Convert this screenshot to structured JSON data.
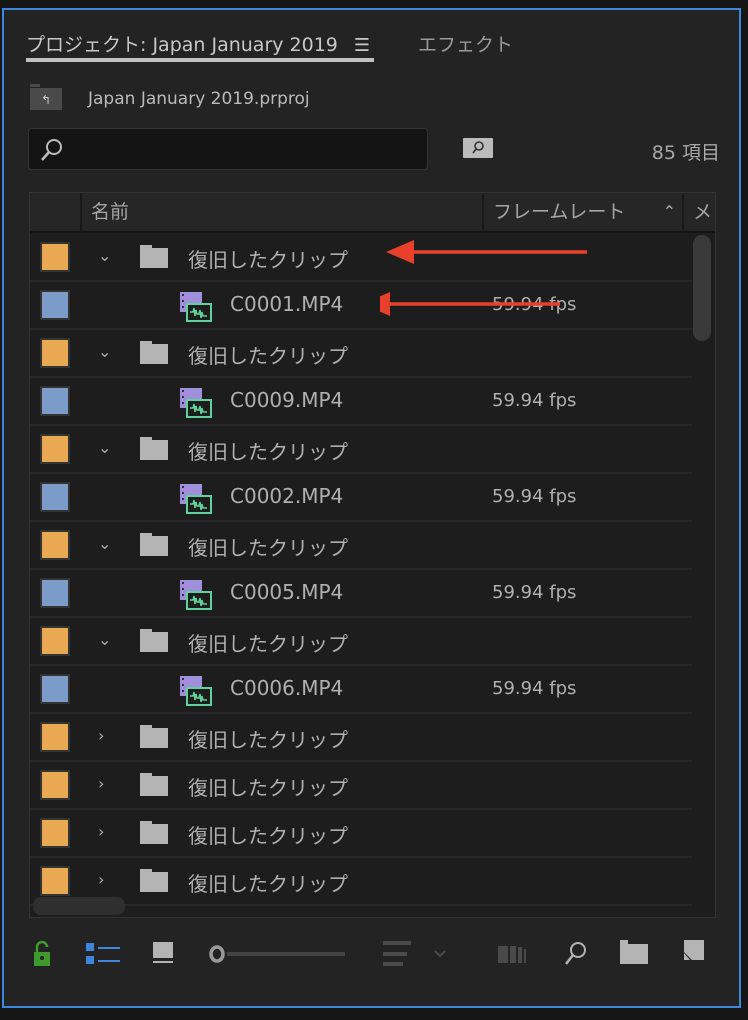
{
  "tabs": [
    {
      "label": "プロジェクト: Japan January 2019",
      "active": true
    },
    {
      "label": "エフェクト",
      "active": false
    }
  ],
  "project_file": "Japan January 2019.prproj",
  "search": {
    "value": "",
    "placeholder": ""
  },
  "item_count": "85 項目",
  "columns": {
    "name": "名前",
    "frame_rate": "フレームレート",
    "more": "メ"
  },
  "rows": [
    {
      "type": "bin",
      "name": "復旧したクリップ",
      "expanded": true,
      "label_color": "#e8a952",
      "fps": ""
    },
    {
      "type": "clip",
      "name": "C0001.MP4",
      "label_color": "#7b9cc9",
      "fps": "59.94 fps"
    },
    {
      "type": "bin",
      "name": "復旧したクリップ",
      "expanded": true,
      "label_color": "#e8a952",
      "fps": ""
    },
    {
      "type": "clip",
      "name": "C0009.MP4",
      "label_color": "#7b9cc9",
      "fps": "59.94 fps"
    },
    {
      "type": "bin",
      "name": "復旧したクリップ",
      "expanded": true,
      "label_color": "#e8a952",
      "fps": ""
    },
    {
      "type": "clip",
      "name": "C0002.MP4",
      "label_color": "#7b9cc9",
      "fps": "59.94 fps"
    },
    {
      "type": "bin",
      "name": "復旧したクリップ",
      "expanded": true,
      "label_color": "#e8a952",
      "fps": ""
    },
    {
      "type": "clip",
      "name": "C0005.MP4",
      "label_color": "#7b9cc9",
      "fps": "59.94 fps"
    },
    {
      "type": "bin",
      "name": "復旧したクリップ",
      "expanded": true,
      "label_color": "#e8a952",
      "fps": ""
    },
    {
      "type": "clip",
      "name": "C0006.MP4",
      "label_color": "#7b9cc9",
      "fps": "59.94 fps"
    },
    {
      "type": "bin",
      "name": "復旧したクリップ",
      "expanded": false,
      "label_color": "#e8a952",
      "fps": ""
    },
    {
      "type": "bin",
      "name": "復旧したクリップ",
      "expanded": false,
      "label_color": "#e8a952",
      "fps": ""
    },
    {
      "type": "bin",
      "name": "復旧したクリップ",
      "expanded": false,
      "label_color": "#e8a952",
      "fps": ""
    },
    {
      "type": "bin",
      "name": "復旧したクリップ",
      "expanded": false,
      "label_color": "#e8a952",
      "fps": ""
    }
  ],
  "colors": {
    "accent": "#3d86db",
    "annotation_arrow": "#e8402a",
    "lock": "#3f9a2e"
  },
  "icons": [
    "lock-open-icon",
    "list-view-icon",
    "icon-view-icon",
    "zoom-slider",
    "sort-icon",
    "automate-icon",
    "find-icon",
    "new-bin-icon",
    "new-item-icon"
  ]
}
